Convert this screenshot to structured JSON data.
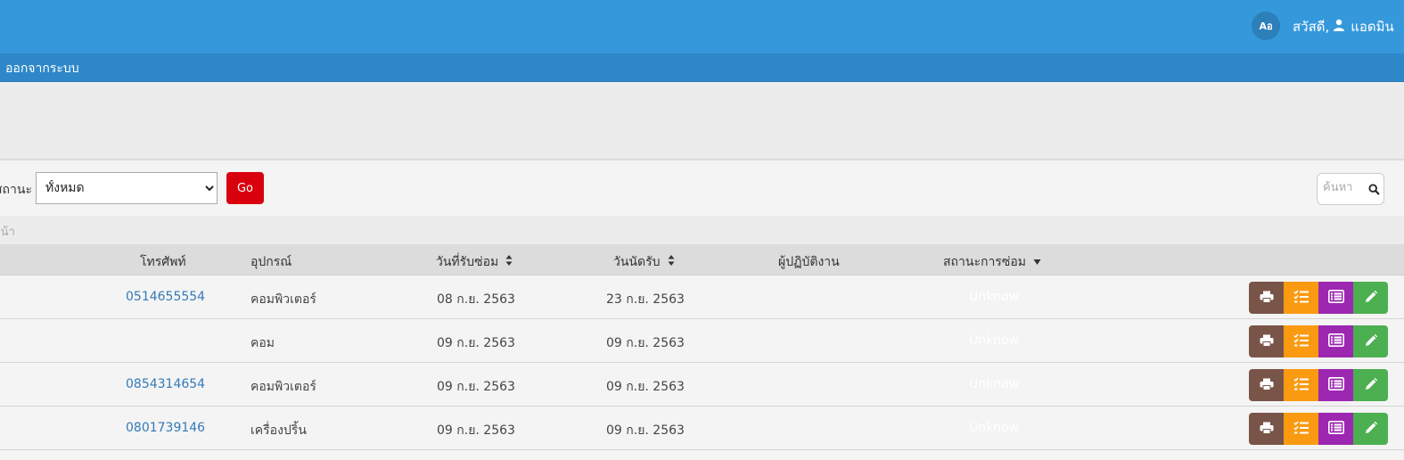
{
  "header": {
    "lang_button": "Aอ",
    "greeting": "สวัสดี,",
    "user_name": "แอดมิน"
  },
  "subnav": {
    "logout": "ออกจากระบบ"
  },
  "filter": {
    "status_label": "สถานะ",
    "status_selected": "ทั้งหมด",
    "go_label": "Go",
    "search_placeholder": "ค้นหา"
  },
  "pager": {
    "label": "หน้า"
  },
  "table": {
    "headers": {
      "phone": "โทรศัพท์",
      "device": "อุปกรณ์",
      "received_date": "วันที่รับซ่อม",
      "appointment_date": "วันนัดรับ",
      "technician": "ผู้ปฏิบัติงาน",
      "repair_status": "สถานะการซ่อม"
    },
    "rows": [
      {
        "phone": "0514655554",
        "device": "คอมพิวเตอร์",
        "received": "08 ก.ย. 2563",
        "appointment": "23 ก.ย. 2563",
        "technician": "",
        "status": "Unknow"
      },
      {
        "phone": "",
        "device": "คอม",
        "received": "09 ก.ย. 2563",
        "appointment": "09 ก.ย. 2563",
        "technician": "",
        "status": "Unknow"
      },
      {
        "phone": "0854314654",
        "device": "คอมพิวเตอร์",
        "received": "09 ก.ย. 2563",
        "appointment": "09 ก.ย. 2563",
        "technician": "",
        "status": "Unknow"
      },
      {
        "phone": "0801739146",
        "device": "เครื่องปริ้น",
        "received": "09 ก.ย. 2563",
        "appointment": "09 ก.ย. 2563",
        "technician": "",
        "status": "Unknow"
      }
    ]
  },
  "colors": {
    "topbar": "#3598db",
    "subbar": "#2e87c8",
    "go_button": "#d9000d",
    "print_button": "#785548",
    "task_button": "#fa9a10",
    "list_button": "#9c27b0",
    "edit_button": "#4caf50",
    "link": "#337ab7"
  },
  "icons": {
    "lang": "translate-icon",
    "user": "user-icon",
    "search": "search-icon",
    "sort": "sort-icon",
    "sort_desc": "caret-down-icon",
    "print": "print-icon",
    "task": "checklist-icon",
    "list": "list-icon",
    "edit": "pencil-icon"
  }
}
